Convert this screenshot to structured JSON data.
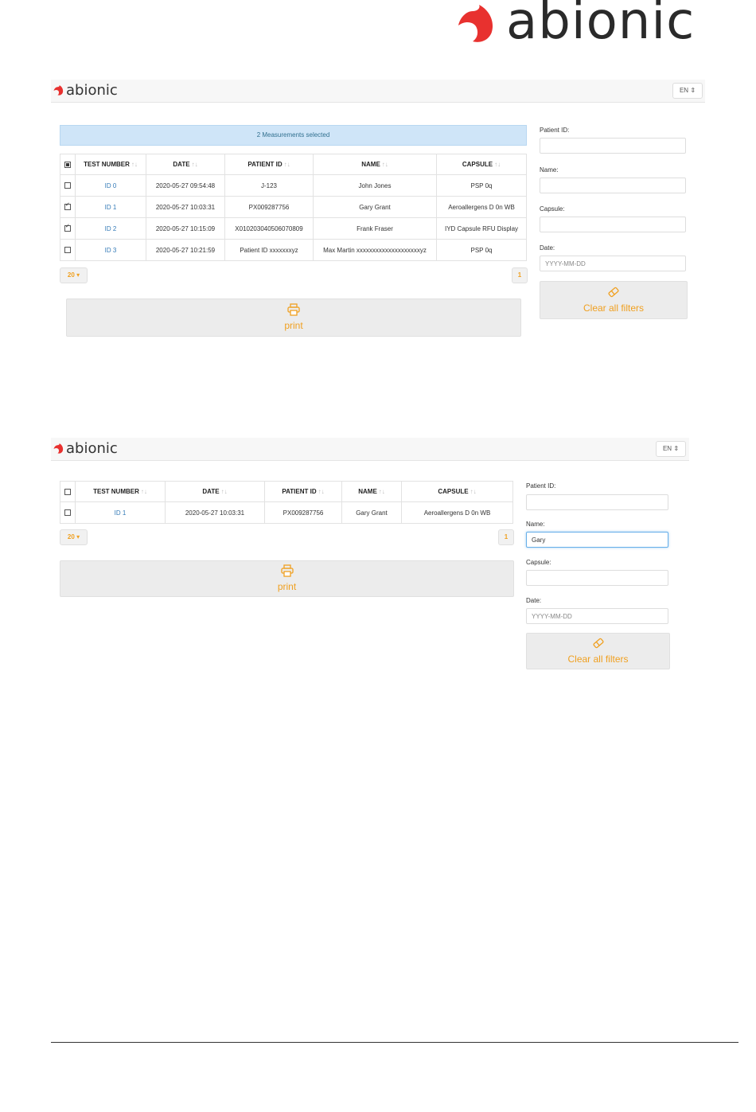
{
  "brand": {
    "name": "abionic",
    "accent": "#e8312f",
    "link_color": "#337ab7",
    "button_text_color": "#f0a020"
  },
  "screen1": {
    "lang": "EN",
    "banner": "2 Measurements selected",
    "table": {
      "headers": [
        "TEST NUMBER",
        "DATE",
        "PATIENT ID",
        "NAME",
        "CAPSULE"
      ],
      "sort_glyph": "↑↓",
      "select_all_state": "partial",
      "rows": [
        {
          "checked": false,
          "test": "ID 0",
          "date": "2020-05-27 09:54:48",
          "patient": "J-123",
          "name": "John Jones",
          "capsule": "PSP 0q"
        },
        {
          "checked": true,
          "test": "ID 1",
          "date": "2020-05-27 10:03:31",
          "patient": "PX009287756",
          "name": "Gary Grant",
          "capsule": "Aeroallergens D 0n WB"
        },
        {
          "checked": true,
          "test": "ID 2",
          "date": "2020-05-27 10:15:09",
          "patient": "X010203040506070809",
          "name": "Frank Fraser",
          "capsule": "IYD Capsule RFU Display"
        },
        {
          "checked": false,
          "test": "ID 3",
          "date": "2020-05-27 10:21:59",
          "patient": "Patient ID xxxxxxxyz",
          "name": "Max Martin xxxxxxxxxxxxxxxxxxxxyz",
          "capsule": "PSP 0q"
        }
      ]
    },
    "page_size": "20",
    "page_number": "1",
    "print_label": "print",
    "filters": {
      "patient_id_label": "Patient ID:",
      "patient_id_value": "",
      "name_label": "Name:",
      "name_value": "",
      "capsule_label": "Capsule:",
      "capsule_value": "",
      "date_label": "Date:",
      "date_placeholder": "YYYY-MM-DD",
      "clear_label": "Clear all filters"
    }
  },
  "screen2": {
    "lang": "EN",
    "table": {
      "headers": [
        "TEST NUMBER",
        "DATE",
        "PATIENT ID",
        "NAME",
        "CAPSULE"
      ],
      "sort_glyph": "↑↓",
      "rows": [
        {
          "checked": false,
          "test": "ID 1",
          "date": "2020-05-27 10:03:31",
          "patient": "PX009287756",
          "name": "Gary Grant",
          "capsule": "Aeroallergens D 0n WB"
        }
      ]
    },
    "page_size": "20",
    "page_number": "1",
    "print_label": "print",
    "filters": {
      "patient_id_label": "Patient ID:",
      "patient_id_value": "",
      "name_label": "Name:",
      "name_value": "Gary",
      "capsule_label": "Capsule:",
      "capsule_value": "",
      "date_label": "Date:",
      "date_placeholder": "YYYY-MM-DD",
      "clear_label": "Clear all filters"
    }
  }
}
